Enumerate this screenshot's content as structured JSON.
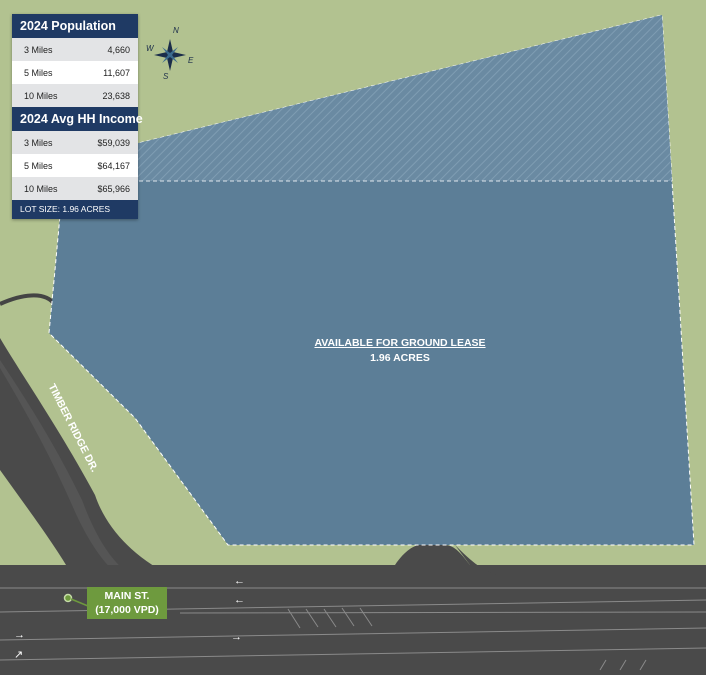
{
  "population": {
    "title": "2024 Population",
    "rows": [
      {
        "label": "3 Miles",
        "value": "4,660"
      },
      {
        "label": "5 Miles",
        "value": "11,607"
      },
      {
        "label": "10 Miles",
        "value": "23,638"
      }
    ]
  },
  "income": {
    "title": "2024 Avg HH Income",
    "rows": [
      {
        "label": "3 Miles",
        "value": "$59,039"
      },
      {
        "label": "5 Miles",
        "value": "$64,167"
      },
      {
        "label": "10 Miles",
        "value": "$65,966"
      }
    ]
  },
  "lot_size": "LOT SIZE: 1.96 ACRES",
  "parcel": {
    "title": "AVAILABLE FOR GROUND LEASE",
    "acres": "1.96 ACRES"
  },
  "main_street": {
    "name": "MAIN ST.",
    "traffic": "(17,000 VPD)"
  },
  "side_road": "TIMBER RIDGE DR.",
  "compass": {
    "n": "N",
    "s": "S",
    "e": "E",
    "w": "W"
  },
  "colors": {
    "grass": "#b2c290",
    "road": "#4a4a4a",
    "parcel": "#5c7e97",
    "panel_header": "#1f3a64",
    "label_green": "#6e9a3e"
  },
  "icons": [
    "compass-rose-icon",
    "arrow-left-icon",
    "arrow-right-icon",
    "location-pin-icon"
  ]
}
